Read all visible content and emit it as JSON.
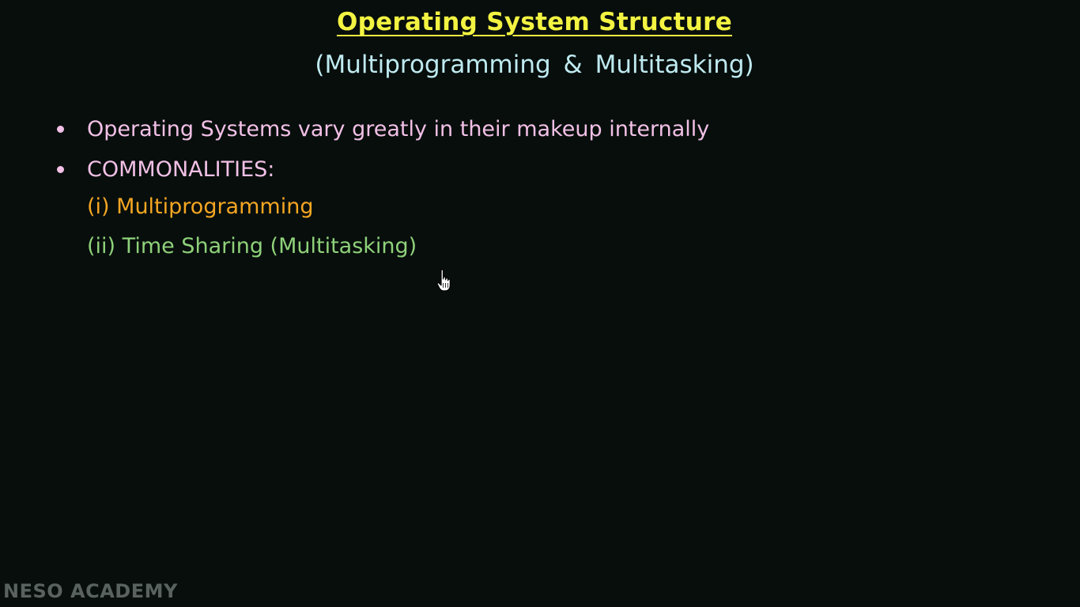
{
  "slide": {
    "title": "Operating System Structure",
    "subtitle": "(Multiprogramming & Multitasking)",
    "bullets": [
      "Operating Systems vary greatly in their makeup internally",
      "COMMONALITIES:"
    ],
    "sub_items": [
      "(i) Multiprogramming",
      "(ii) Time Sharing (Multitasking)"
    ]
  },
  "watermark": "NESO ACADEMY",
  "colors": {
    "background": "#070e0c",
    "title": "#f3f342",
    "subtitle": "#bfeaf0",
    "bullet_text": "#f2c0e6",
    "sub_item_1": "#f5a623",
    "sub_item_2": "#8fd17a"
  },
  "icons": {
    "cursor": "hand-pointer-cursor"
  }
}
